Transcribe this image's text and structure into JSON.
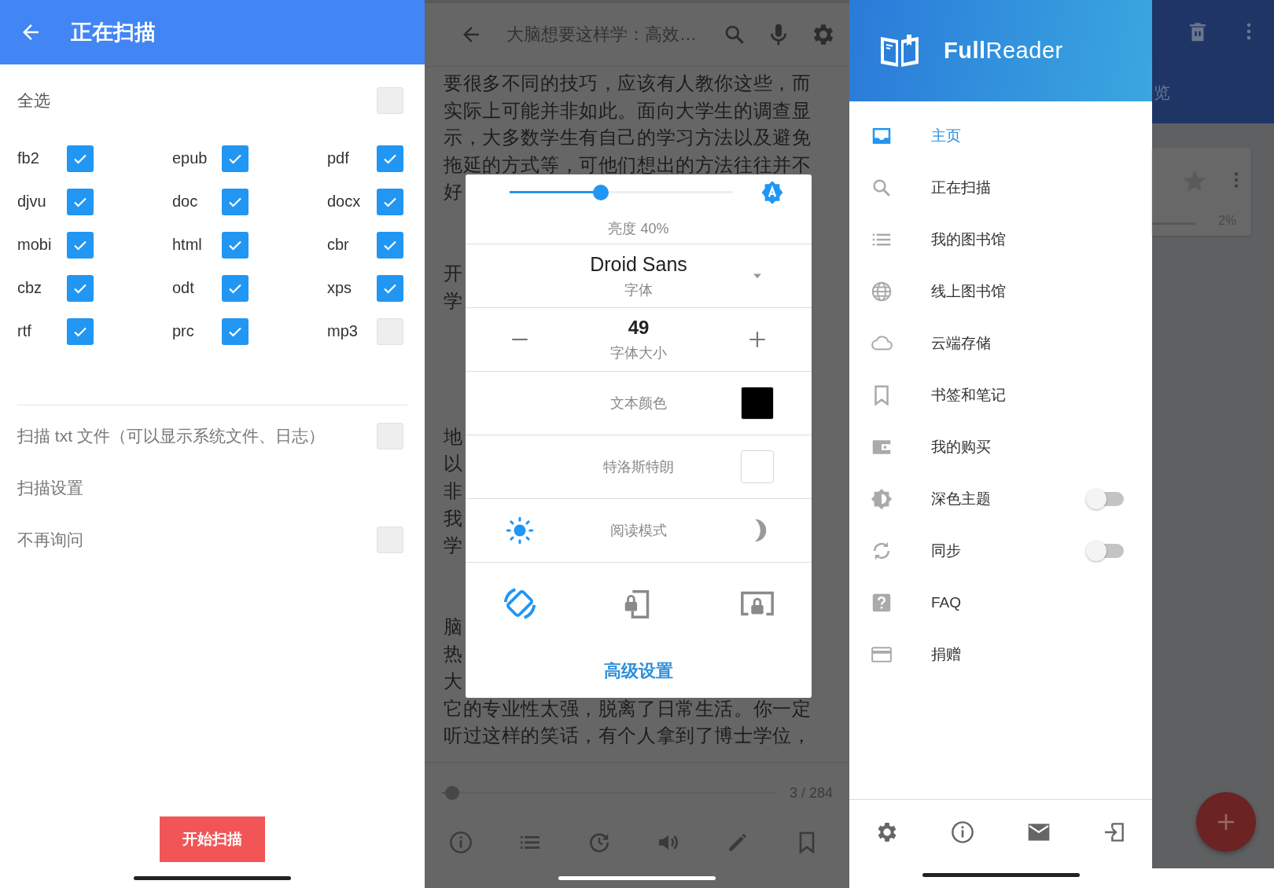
{
  "scan_screen": {
    "title": "正在扫描",
    "select_all": {
      "label": "全选",
      "checked": false
    },
    "formats": [
      {
        "label": "fb2",
        "checked": true
      },
      {
        "label": "epub",
        "checked": true
      },
      {
        "label": "pdf",
        "checked": true
      },
      {
        "label": "djvu",
        "checked": true
      },
      {
        "label": "doc",
        "checked": true
      },
      {
        "label": "docx",
        "checked": true
      },
      {
        "label": "mobi",
        "checked": true
      },
      {
        "label": "html",
        "checked": true
      },
      {
        "label": "cbr",
        "checked": true
      },
      {
        "label": "cbz",
        "checked": true
      },
      {
        "label": "odt",
        "checked": true
      },
      {
        "label": "xps",
        "checked": true
      },
      {
        "label": "rtf",
        "checked": true
      },
      {
        "label": "prc",
        "checked": true
      },
      {
        "label": "mp3",
        "checked": false
      }
    ],
    "options": [
      {
        "kind": "checkbox",
        "label": "扫描 txt 文件（可以显示系统文件、日志）",
        "checked": false
      },
      {
        "kind": "link",
        "label": "扫描设置"
      },
      {
        "kind": "checkbox",
        "label": "不再询问",
        "checked": false
      }
    ],
    "start_button": "开始扫描"
  },
  "reader_screen": {
    "title": "大脑想要这样学：高效…",
    "lines": [
      {
        "kind": "text",
        "text": "要很多不同的技巧，应该有人教你这些，而"
      },
      {
        "kind": "text",
        "text": "实际上可能并非如此。面向大学生的调查显"
      },
      {
        "kind": "text",
        "text": "示，大多数学生有自己的学习方法以及避免"
      },
      {
        "kind": "text",
        "text": "拖延的方式等，可他们想出的方法往往并不"
      },
      {
        "kind": "text",
        "text": "好"
      },
      {
        "kind": "gap"
      },
      {
        "kind": "gap"
      },
      {
        "kind": "text",
        "text": "开"
      },
      {
        "kind": "text",
        "text": "学"
      },
      {
        "kind": "gap"
      },
      {
        "kind": "gap"
      },
      {
        "kind": "gap"
      },
      {
        "kind": "gap"
      },
      {
        "kind": "text",
        "text": "地"
      },
      {
        "kind": "text",
        "text": "以"
      },
      {
        "kind": "text",
        "text": "非"
      },
      {
        "kind": "text",
        "text": "我"
      },
      {
        "kind": "text",
        "text": "学"
      },
      {
        "kind": "gap"
      },
      {
        "kind": "gap"
      },
      {
        "kind": "text",
        "text": "脑"
      },
      {
        "kind": "text",
        "text": "热"
      },
      {
        "kind": "text",
        "text": "大"
      },
      {
        "kind": "text",
        "text": "它的专业性太强，脱离了日常生活。你一定"
      },
      {
        "kind": "text",
        "text": "听过这样的笑话，有个人拿到了博士学位，"
      }
    ],
    "settings_dialog": {
      "brightness": {
        "level": 0.4,
        "label": "亮度 40%",
        "auto": true
      },
      "font": {
        "value": "Droid Sans",
        "label": "字体"
      },
      "font_size": {
        "value": "49",
        "label": "字体大小"
      },
      "text_color": {
        "label": "文本颜色",
        "color": "#000000"
      },
      "bionic": {
        "label": "特洛斯特朗",
        "checked": false
      },
      "reading_mode": {
        "label": "阅读模式",
        "night": false
      },
      "orientation": [
        {
          "kind": "auto",
          "selected": true
        },
        {
          "kind": "portrait-lock",
          "selected": false
        },
        {
          "kind": "landscape-lock",
          "selected": false
        }
      ],
      "advanced_link": "高级设置"
    },
    "page_slider": {
      "level": 0.01
    },
    "page_indicator": "3 / 284"
  },
  "library_screen": {
    "drawer": {
      "app_name": "**Full**Reader",
      "items": [
        {
          "kind": "link",
          "label": "主页",
          "selected": true
        },
        {
          "kind": "link",
          "label": "正在扫描",
          "selected": false
        },
        {
          "kind": "link",
          "label": "我的图书馆",
          "selected": false
        },
        {
          "kind": "link",
          "label": "线上图书馆",
          "selected": false
        },
        {
          "kind": "link",
          "label": "云端存储",
          "selected": false
        },
        {
          "kind": "link",
          "label": "书签和笔记",
          "selected": false
        },
        {
          "kind": "link",
          "label": "我的购买",
          "selected": false
        },
        {
          "kind": "toggle",
          "label": "深色主题",
          "selected": false,
          "on": false
        },
        {
          "kind": "toggle",
          "label": "同步",
          "selected": false,
          "on": false
        },
        {
          "kind": "link",
          "label": "FAQ",
          "selected": false
        },
        {
          "kind": "link",
          "label": "捐赠",
          "selected": false
        }
      ]
    },
    "background": {
      "tab_fragment": "览",
      "book": {
        "favorite": false,
        "progress": "2%",
        "level": 0.02
      }
    }
  }
}
